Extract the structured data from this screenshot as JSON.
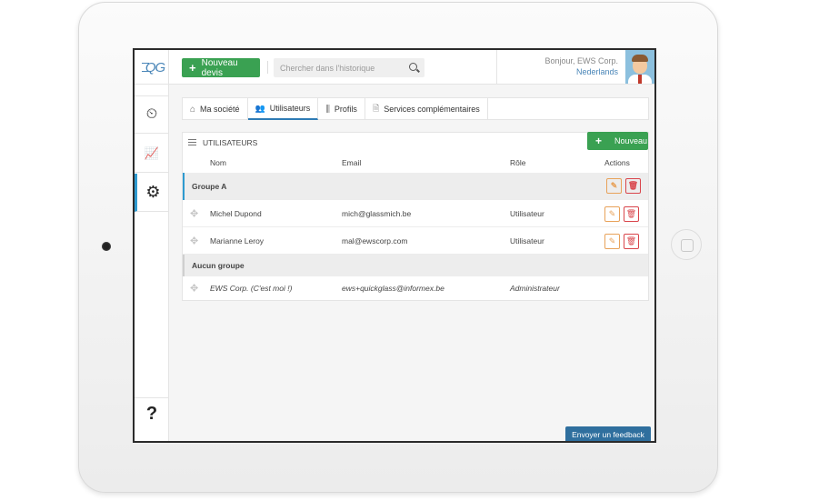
{
  "header": {
    "logo_text": "QG",
    "new_quote_label": "Nouveau devis",
    "search_placeholder": "Chercher dans l'historique",
    "greeting": "Bonjour, EWS Corp.",
    "language": "Nederlands"
  },
  "sidebar": {
    "items": [
      {
        "name": "history-icon",
        "glyph": "⏲"
      },
      {
        "name": "stats-icon",
        "glyph": "📈"
      },
      {
        "name": "settings-icon",
        "glyph": "⚙"
      }
    ],
    "help": "?"
  },
  "tabs": [
    {
      "label": "Ma société",
      "icon": "home-icon",
      "glyph": "⌂"
    },
    {
      "label": "Utilisateurs",
      "icon": "users-icon",
      "glyph": "👥"
    },
    {
      "label": "Profils",
      "icon": "sliders-icon",
      "glyph": "⫼"
    },
    {
      "label": "Services complémentaires",
      "icon": "document-icon",
      "glyph": "🗎"
    }
  ],
  "active_tab": "Utilisateurs",
  "panel": {
    "title": "UTILISATEURS",
    "new_label": "Nouveau",
    "columns": {
      "name": "Nom",
      "email": "Email",
      "role": "Rôle",
      "actions": "Actions"
    },
    "groups": [
      {
        "label": "Groupe A",
        "users": [
          {
            "name": "Michel Dupond",
            "email": "mich@glassmich.be",
            "role": "Utilisateur"
          },
          {
            "name": "Marianne Leroy",
            "email": "mal@ewscorp.com",
            "role": "Utilisateur"
          }
        ]
      },
      {
        "label": "Aucun groupe",
        "users": [
          {
            "name": "EWS Corp. (C'est moi !)",
            "email": "ews+quickglass@informex.be",
            "role": "Administrateur"
          }
        ]
      }
    ]
  },
  "feedback_label": "Envoyer un feedback",
  "colors": {
    "accent_green": "#3aa152",
    "accent_blue": "#2e9ad0",
    "feedback_blue": "#2f6f9e",
    "edit_orange": "#e8a25a",
    "delete_red": "#d9454b"
  }
}
